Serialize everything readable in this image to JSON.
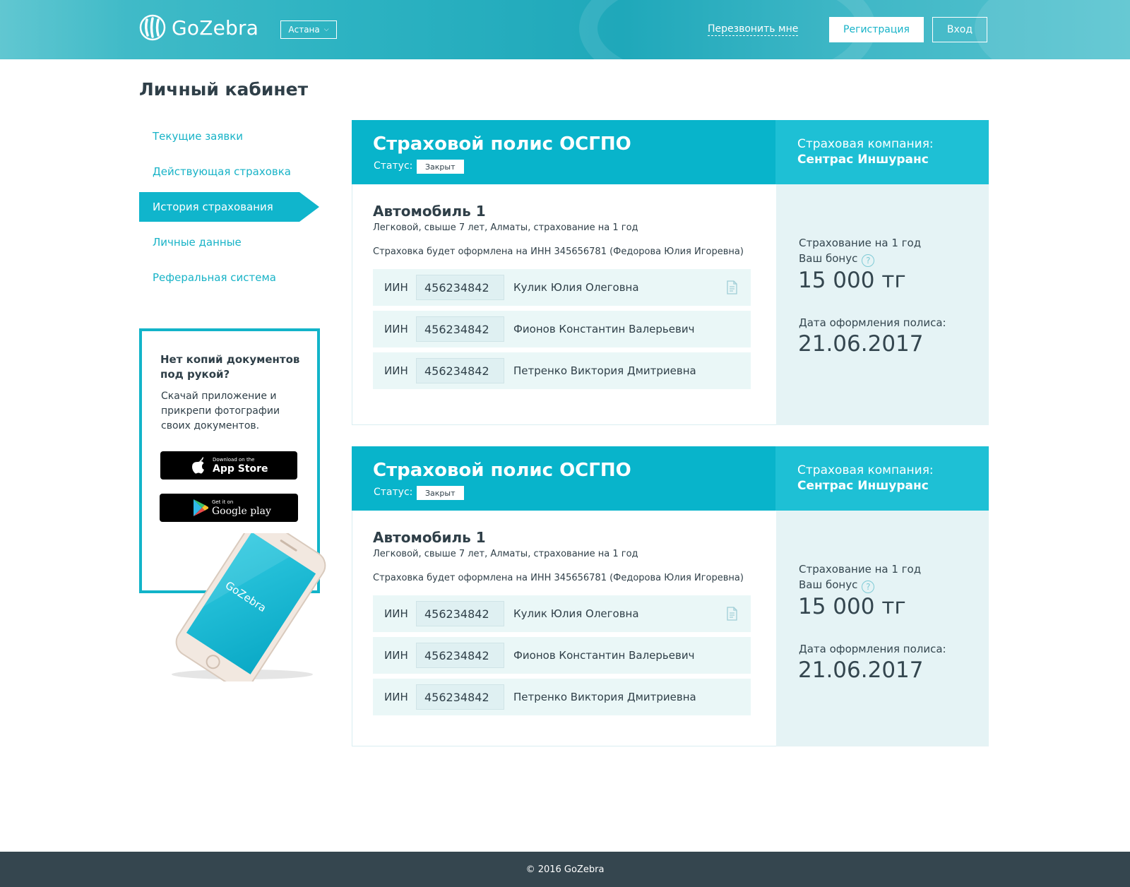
{
  "header": {
    "brand": "GoZebra",
    "city": "Астана",
    "callback": "Перезвонить мне",
    "register": "Регистрация",
    "login": "Вход"
  },
  "page_title": "Личный кабинет",
  "sidebar": {
    "items": [
      {
        "label": "Текущие заявки",
        "active": false
      },
      {
        "label": "Действующая страховка",
        "active": false
      },
      {
        "label": "История страхования",
        "active": true
      },
      {
        "label": "Личные данные",
        "active": false
      },
      {
        "label": "Реферальная система",
        "active": false
      }
    ],
    "promo": {
      "title": "Нет копий документов под рукой?",
      "text": "Скачай приложение и прикрепи фотографии своих документов.",
      "appstore_small": "Download on the",
      "appstore_big": "App Store",
      "google_small": "Get it on",
      "google_big": "Google play",
      "phone_brand": "GoZebra"
    }
  },
  "policies": [
    {
      "title": "Страховой полис ОСГПО",
      "status_label": "Статус:",
      "status": "Закрыт",
      "company_label": "Страховая компания:",
      "company_name": "Сентрас Иншуранс",
      "car_title": "Автомобиль 1",
      "car_sub": "Легковой, свыше 7 лет, Алматы, страхование на 1 год",
      "insured_note": "Страховка будет оформлена на ИНН 345656781 (Федорова Юлия Игоревна)",
      "persons": [
        {
          "iin_label": "ИИН",
          "iin": "456234842",
          "name": "Кулик Юлия Олеговна"
        },
        {
          "iin_label": "ИИН",
          "iin": "456234842",
          "name": "Фионов Константин Валерьевич"
        },
        {
          "iin_label": "ИИН",
          "iin": "456234842",
          "name": "Петренко Виктория Дмитриевна"
        }
      ],
      "term": "Страхование на 1 год",
      "bonus_label": "Ваш бонус",
      "bonus_value": "15 000 тг",
      "date_label": "Дата оформления полиса:",
      "date_value": "21.06.2017"
    },
    {
      "title": "Страховой полис ОСГПО",
      "status_label": "Статус:",
      "status": "Закрыт",
      "company_label": "Страховая компания:",
      "company_name": "Сентрас Иншуранс",
      "car_title": "Автомобиль 1",
      "car_sub": "Легковой, свыше 7 лет, Алматы, страхование на 1 год",
      "insured_note": "Страховка будет оформлена на ИНН 345656781 (Федорова Юлия Игоревна)",
      "persons": [
        {
          "iin_label": "ИИН",
          "iin": "456234842",
          "name": "Кулик Юлия Олеговна"
        },
        {
          "iin_label": "ИИН",
          "iin": "456234842",
          "name": "Фионов Константин Валерьевич"
        },
        {
          "iin_label": "ИИН",
          "iin": "456234842",
          "name": "Петренко Виктория Дмитриевна"
        }
      ],
      "term": "Страхование на 1 год",
      "bonus_label": "Ваш бонус",
      "bonus_value": "15 000 тг",
      "date_label": "Дата оформления полиса:",
      "date_value": "21.06.2017"
    }
  ],
  "footer": {
    "copyright": "© 2016 GoZebra"
  },
  "colors": {
    "accent": "#08b4cb",
    "accent_light": "#1ec0d5",
    "panel": "#e5f3f5",
    "row": "#eaf7f7",
    "footer": "#35464f",
    "text": "#2f3f48"
  }
}
